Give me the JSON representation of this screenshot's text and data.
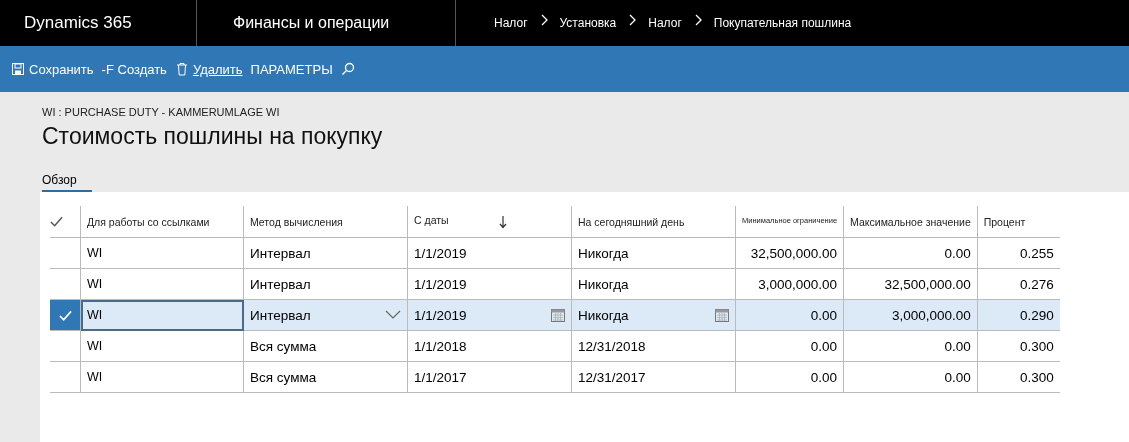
{
  "topbar": {
    "brand": "Dynamics 365",
    "module": "Финансы и операции",
    "breadcrumbs": [
      "Налог",
      "Установка",
      "Налог",
      "Покупательная пошлина"
    ]
  },
  "toolbar": [
    {
      "kind": "save",
      "label": "Сохранить"
    },
    {
      "kind": "new",
      "label": "-F Создать"
    },
    {
      "kind": "delete",
      "label": "Удалить"
    },
    {
      "kind": "text",
      "label": "ПАРАМЕТРЫ"
    },
    {
      "kind": "search"
    }
  ],
  "page": {
    "caption": "WI : PURCHASE DUTY - KAMMERUMLAGE WI",
    "title": "Стоимость пошлины на покупку"
  },
  "tabs": [
    {
      "label": "Обзор",
      "selected": true
    }
  ],
  "table": {
    "columns": [
      {
        "label": "Для работы со ссылками",
        "kind": "text",
        "sorted": false,
        "small": false
      },
      {
        "label": "Метод вычисления",
        "kind": "dropdown",
        "sorted": false,
        "small": false
      },
      {
        "label": "С даты",
        "kind": "date",
        "sorted": true,
        "small": false
      },
      {
        "label": "На сегодняшний день",
        "kind": "date",
        "sorted": false,
        "small": false
      },
      {
        "label": "Минимальное ограничение",
        "kind": "number",
        "sorted": false,
        "small": true
      },
      {
        "label": "Максимальное значение",
        "kind": "number",
        "sorted": false,
        "small": false
      },
      {
        "label": "Процент",
        "kind": "number",
        "sorted": false,
        "small": false
      }
    ],
    "rows": [
      {
        "selected": false,
        "cells": [
          "WI",
          "Интервал",
          "1/1/2019",
          "Никогда",
          "32,500,000.00",
          "0.00",
          "0.255"
        ]
      },
      {
        "selected": false,
        "cells": [
          "WI",
          "Интервал",
          "1/1/2019",
          "Никогда",
          "3,000,000.00",
          "32,500,000.00",
          "0.276"
        ]
      },
      {
        "selected": true,
        "cells": [
          "WI",
          "Интервал",
          "1/1/2019",
          "Никогда",
          "0.00",
          "3,000,000.00",
          "0.290"
        ]
      },
      {
        "selected": false,
        "cells": [
          "WI",
          "Вся сумма",
          "1/1/2018",
          "12/31/2018",
          "0.00",
          "0.00",
          "0.300"
        ]
      },
      {
        "selected": false,
        "cells": [
          "WI",
          "Вся сумма",
          "1/1/2017",
          "12/31/2017",
          "0.00",
          "0.00",
          "0.300"
        ]
      }
    ]
  }
}
